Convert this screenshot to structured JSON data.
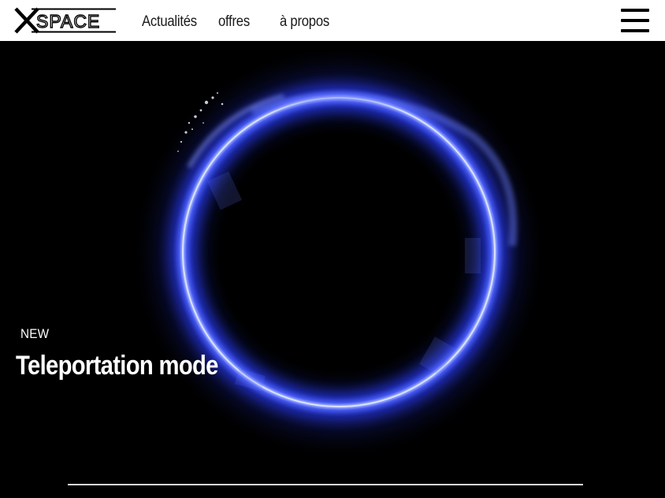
{
  "header": {
    "logo": {
      "text": "XSPACE"
    },
    "nav": {
      "items": [
        {
          "label": "Actualités"
        },
        {
          "label": "offres"
        },
        {
          "label": "à propos"
        }
      ]
    },
    "menu_icon": "hamburger-icon"
  },
  "hero": {
    "tag": "NEW",
    "title": "Teleportation mode"
  },
  "colors": {
    "header_bg": "#ffffff",
    "hero_bg": "#000000",
    "portal_glow": "#3b4cff",
    "text_light": "#ffffff"
  }
}
